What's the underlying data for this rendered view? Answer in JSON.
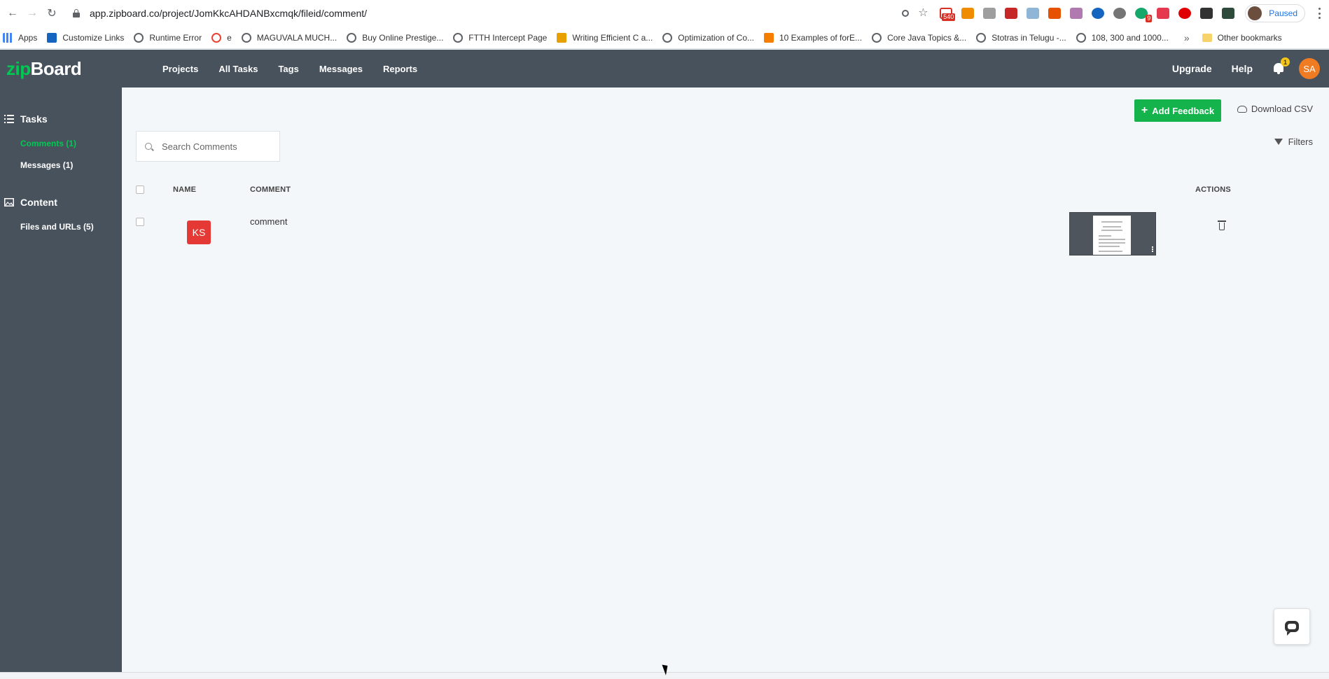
{
  "browser": {
    "url": "app.zipboard.co/project/JomKkcAHDANBxcmqk/fileid/comment/",
    "profile_status": "Paused",
    "gmail_badge": "540",
    "ext_badge": "9",
    "bookmarks": [
      {
        "label": "Apps",
        "icon": "apps-icon"
      },
      {
        "label": "Customize Links",
        "icon": "m-icon"
      },
      {
        "label": "Runtime Error",
        "icon": "globe-icon"
      },
      {
        "label": "e",
        "icon": "google-icon"
      },
      {
        "label": "MAGUVALA MUCH...",
        "icon": "globe-icon"
      },
      {
        "label": "Buy Online Prestige...",
        "icon": "globe-icon"
      },
      {
        "label": "FTTH Intercept Page",
        "icon": "globe-icon"
      },
      {
        "label": "Writing Efficient C a...",
        "icon": "book-icon"
      },
      {
        "label": "Optimization of Co...",
        "icon": "globe-icon"
      },
      {
        "label": "10 Examples of forE...",
        "icon": "blogger-icon"
      },
      {
        "label": "Core Java Topics &...",
        "icon": "globe-icon"
      },
      {
        "label": "Stotras in Telugu -...",
        "icon": "globe-icon"
      },
      {
        "label": "108, 300 and 1000...",
        "icon": "globe-icon"
      }
    ],
    "more": "»",
    "other_bookmarks": "Other bookmarks"
  },
  "header": {
    "logo_zip": "zip",
    "logo_board": "Board",
    "nav": [
      "Projects",
      "All Tasks",
      "Tags",
      "Messages",
      "Reports"
    ],
    "upgrade": "Upgrade",
    "help": "Help",
    "notification_count": "1",
    "user_initials": "SA"
  },
  "sidebar": {
    "tasks_title": "Tasks",
    "comments": "Comments (1)",
    "messages": "Messages (1)",
    "content_title": "Content",
    "files": "Files and URLs (5)"
  },
  "toolbar": {
    "add_feedback": "Add Feedback",
    "download_csv": "Download CSV",
    "filters": "Filters",
    "search_placeholder": "Search Comments"
  },
  "table": {
    "headers": {
      "name": "NAME",
      "comment": "COMMENT",
      "actions": "ACTIONS"
    },
    "rows": [
      {
        "initials": "KS",
        "comment": "comment"
      }
    ]
  },
  "colors": {
    "accent_green": "#14b34c",
    "sidebar_bg": "#48525d",
    "avatar_red": "#e53935",
    "user_orange": "#ef7b22"
  }
}
